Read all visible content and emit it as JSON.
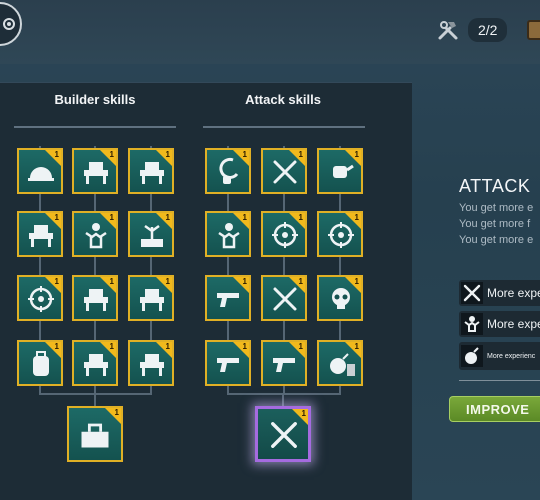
{
  "top_bar": {
    "builders_count": "2/2",
    "settings_icon": "gear-icon",
    "builders_icon": "hammer-wrench-icon",
    "chest_icon": "chest-icon"
  },
  "builder_skills": {
    "title": "Builder skills",
    "skills": [
      {
        "icon": "helmet-icon",
        "level": "1"
      },
      {
        "icon": "workbench-icon",
        "level": "1"
      },
      {
        "icon": "saw-table-icon",
        "level": "1"
      },
      {
        "icon": "tools-table-icon",
        "level": "1"
      },
      {
        "icon": "worker-icon",
        "level": "1"
      },
      {
        "icon": "plant-table-icon",
        "level": "1"
      },
      {
        "icon": "saw-blade-icon",
        "level": "1"
      },
      {
        "icon": "workbench-icon",
        "level": "1"
      },
      {
        "icon": "chest-bench-icon",
        "level": "1"
      },
      {
        "icon": "backpack-icon",
        "level": "1"
      },
      {
        "icon": "materials-icon",
        "level": "1"
      },
      {
        "icon": "crafting-table-icon",
        "level": "1"
      }
    ],
    "final": {
      "icon": "toolbox-icon",
      "level": "1"
    }
  },
  "attack_skills": {
    "title": "Attack skills",
    "skills": [
      {
        "icon": "hook-icon",
        "level": "1"
      },
      {
        "icon": "knife-icon",
        "level": "1"
      },
      {
        "icon": "fist-punch-icon",
        "level": "1"
      },
      {
        "icon": "strong-man-icon",
        "level": "1"
      },
      {
        "icon": "bear-target-icon",
        "level": "1"
      },
      {
        "icon": "target-arrow-icon",
        "level": "1"
      },
      {
        "icon": "pistol-crosshair-icon",
        "level": "1"
      },
      {
        "icon": "knife-crosshair-icon",
        "level": "1"
      },
      {
        "icon": "skull-crosshair-icon",
        "level": "1"
      },
      {
        "icon": "pistol-ammo-icon",
        "level": "1"
      },
      {
        "icon": "pistol-plus-icon",
        "level": "1"
      },
      {
        "icon": "bomb-wall-icon",
        "level": "1"
      }
    ],
    "final": {
      "icon": "crossed-knives-icon",
      "level": "1"
    }
  },
  "info": {
    "title": "ATTACK",
    "lines": [
      "You get more e",
      "You get more f",
      "You get more e"
    ],
    "rewards": [
      {
        "icon": "crossed-knives-icon",
        "text": "More expe"
      },
      {
        "icon": "strong-man-icon",
        "text": "More expe"
      },
      {
        "icon": "bomb-icon",
        "text": "More experienc"
      }
    ],
    "improve_label": "IMPROVE"
  },
  "colors": {
    "skill_border": "#e0b025",
    "level_badge": "#f1b91c",
    "selected_border": "#a56be0",
    "improve_button": "#6b9a30"
  }
}
